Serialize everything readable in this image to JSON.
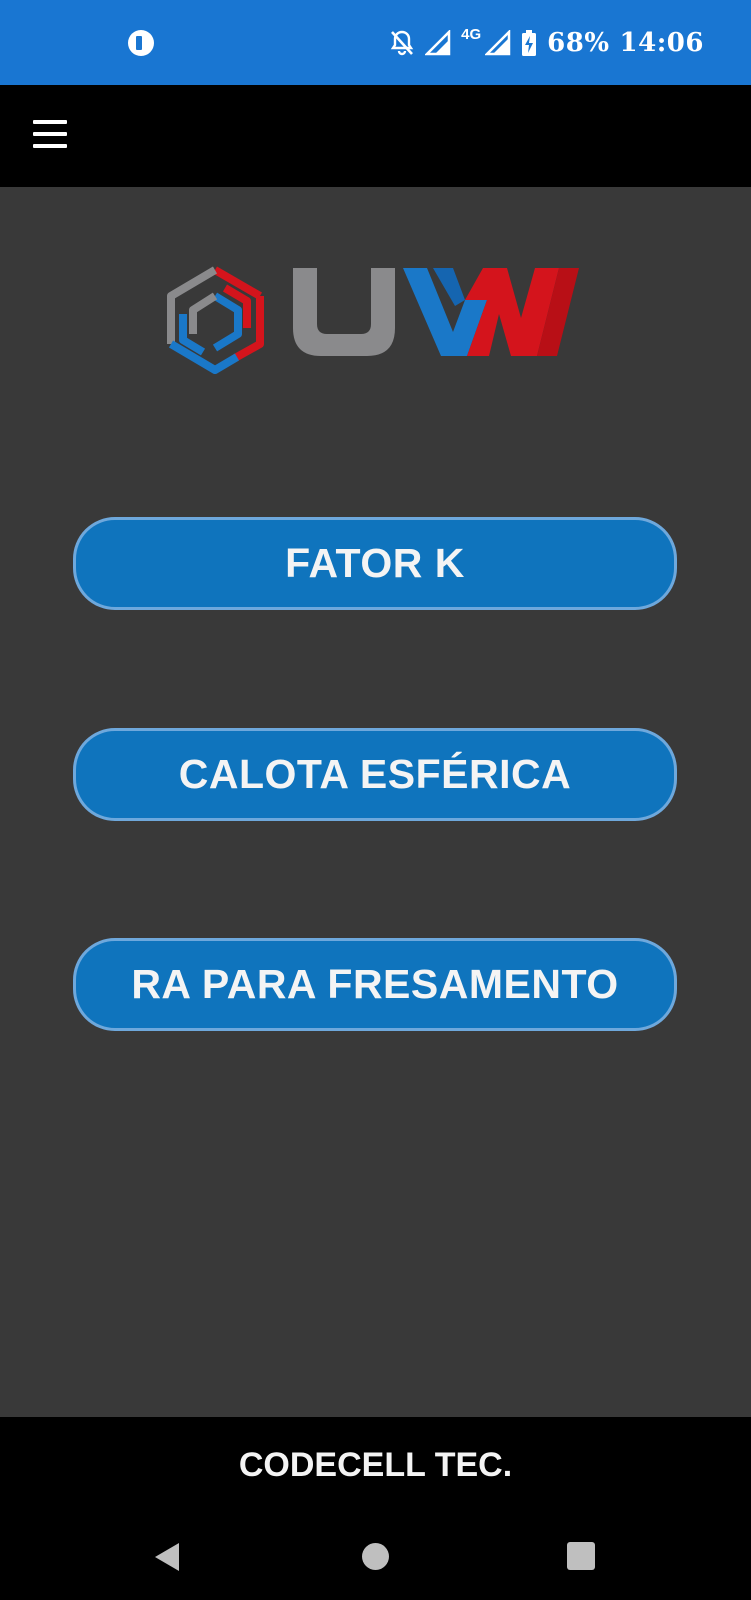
{
  "status_bar": {
    "battery_percent": "68%",
    "time": "14:06",
    "network_type": "4G",
    "icons": [
      "app-notification-icon",
      "notifications-off-icon",
      "signal-icon",
      "signal-icon",
      "battery-charging-icon"
    ]
  },
  "app_bar": {
    "menu_icon": "hamburger-menu-icon"
  },
  "logo": {
    "text": "UVW",
    "colors": {
      "gray": "#8a8a8c",
      "blue": "#1a78c8",
      "red": "#d4141c"
    }
  },
  "menu": {
    "items": [
      {
        "label": "FATOR K"
      },
      {
        "label": "CALOTA ESFÉRICA"
      },
      {
        "label": "RA PARA FRESAMENTO"
      }
    ]
  },
  "footer": {
    "text": "CODECELL TEC."
  },
  "nav_bar": {
    "icons": [
      "back-icon",
      "home-icon",
      "recent-apps-icon"
    ]
  },
  "colors": {
    "status_bar": "#1976d2",
    "background": "#393939",
    "button": "#0f74bd",
    "button_border": "#6ea8dc"
  }
}
